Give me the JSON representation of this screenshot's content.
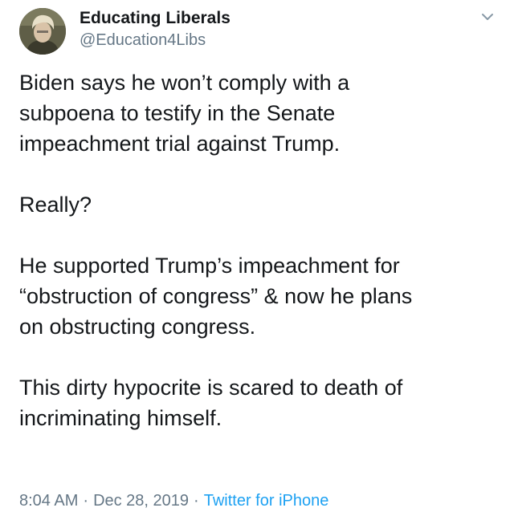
{
  "author": {
    "display_name": "Educating Liberals",
    "handle": "@Education4Libs",
    "avatar_icon": "profile-photo"
  },
  "menu_icon": "chevron-down-icon",
  "tweet": {
    "paragraphs": [
      "Biden says he won’t comply with a\nsubpoena to testify in the Senate\nimpeachment trial against Trump.",
      "Really?",
      "He supported Trump’s impeachment for\n“obstruction of congress” & now he plans\non obstructing congress.",
      "This dirty hypocrite is scared to death of\nincriminating himself."
    ],
    "time": "8:04 AM",
    "date": "Dec 28, 2019",
    "separator": "·",
    "source": "Twitter for iPhone"
  },
  "colors": {
    "text": "#14171a",
    "secondary": "#657786",
    "link": "#1da1f2"
  }
}
